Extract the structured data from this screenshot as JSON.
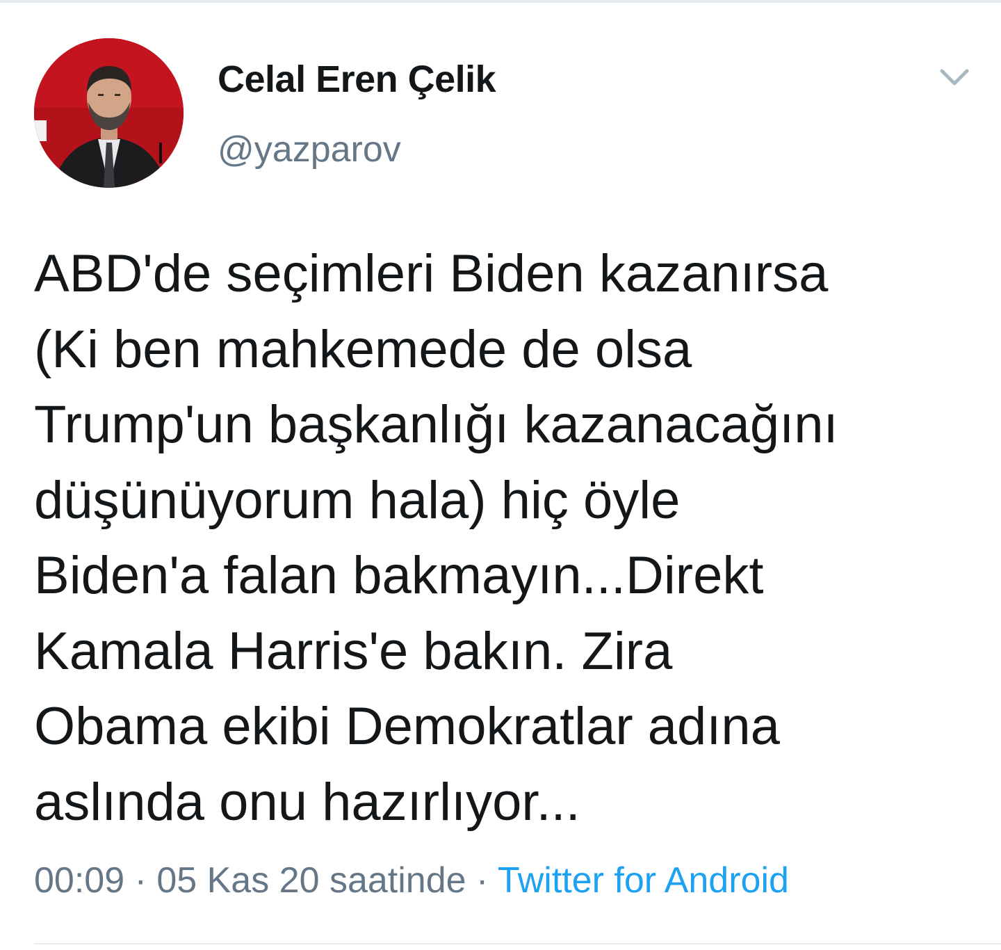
{
  "tweet": {
    "author": {
      "display_name": "Celal Eren Çelik",
      "handle": "@yazparov"
    },
    "text": "ABD'de seçimleri Biden kazanırsa\n(Ki ben mahkemede de olsa\nTrump'un başkanlığı kazanacağını\ndüşünüyorum hala) hiç öyle\nBiden'a falan bakmayın...Direkt\nKamala Harris'e bakın. Zira\nObama ekibi Demokratlar adına\naslında onu hazırlıyor...",
    "timestamp": "00:09 · 05 Kas 20 saatinde",
    "separator": " · ",
    "source": "Twitter for Android"
  },
  "icons": {
    "menu": "chevron-down-icon"
  },
  "colors": {
    "text": "#14171a",
    "secondary": "#657786",
    "link": "#1da1f2",
    "divider": "#e6ecf0"
  }
}
